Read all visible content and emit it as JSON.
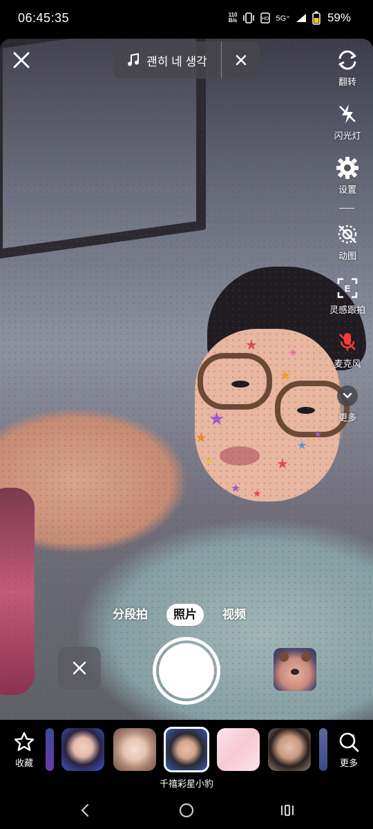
{
  "status_bar": {
    "time": "06:45:35",
    "net_speed_value": "110",
    "net_speed_unit": "B/s",
    "network": "5G⁺",
    "battery": "59%"
  },
  "music": {
    "title": "괜히 네 생각"
  },
  "toolbar": {
    "flip": "翻转",
    "flash": "闪光灯",
    "settings": "设置",
    "animation": "动图",
    "inspiration": "灵感跟拍",
    "microphone": "麦克风",
    "more": "更多"
  },
  "modes": {
    "segment": "分段拍",
    "photo": "照片",
    "video": "视频",
    "active": "照片"
  },
  "effects_bar": {
    "favorites": "收藏",
    "more": "更多",
    "selected_effect": "千禧彩星小豹",
    "items": [
      {
        "name": "effect-thumb-1"
      },
      {
        "name": "effect-thumb-2"
      },
      {
        "name": "effect-thumb-3"
      },
      {
        "name": "effect-thumb-4"
      },
      {
        "name": "effect-thumb-5"
      },
      {
        "name": "effect-thumb-6"
      }
    ]
  },
  "colors": {
    "mic_muted": "#ff3b3b",
    "pill_bg": "#46464c"
  }
}
